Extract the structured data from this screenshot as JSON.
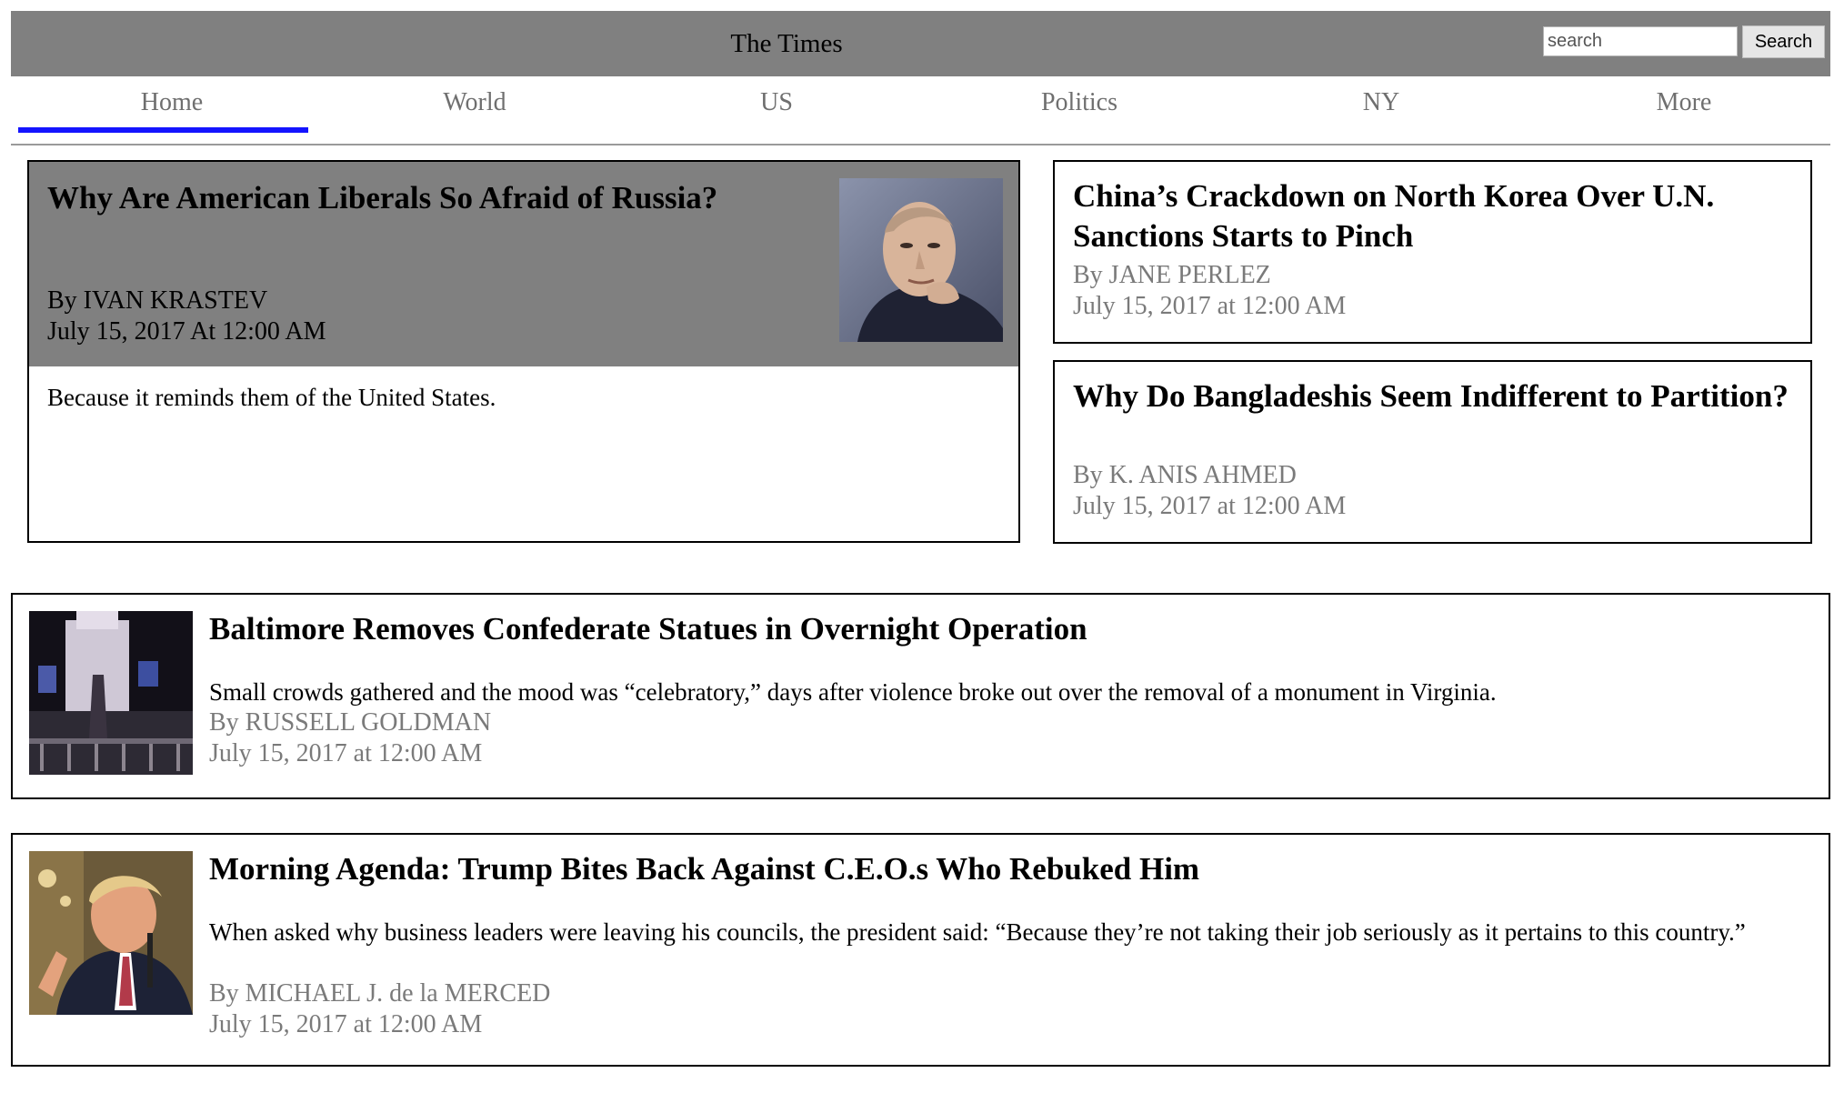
{
  "header": {
    "site_title": "The Times",
    "search_placeholder": "search",
    "search_button_label": "Search",
    "background_color": "#808080"
  },
  "nav": {
    "active_index": 0,
    "underline_color": "#1414ff",
    "tabs": [
      {
        "label": "Home"
      },
      {
        "label": "World"
      },
      {
        "label": "US"
      },
      {
        "label": "Politics"
      },
      {
        "label": "NY"
      },
      {
        "label": "More"
      }
    ]
  },
  "featured": {
    "title": "Why Are American Liberals So Afraid of Russia?",
    "byline": "By IVAN KRASTEV",
    "date": "July 15, 2017 At 12:00 AM",
    "summary": "Because it reminds them of the United States.",
    "photo_icon": "portrait-photo"
  },
  "side_articles": [
    {
      "title": "China’s Crackdown on North Korea Over U.N. Sanctions Starts to Pinch",
      "byline": "By JANE PERLEZ",
      "date": "July 15, 2017 at 12:00 AM"
    },
    {
      "title": "Why Do Bangladeshis Seem Indifferent to Partition?",
      "byline": "By K. ANIS AHMED",
      "date": "July 15, 2017 at 12:00 AM"
    }
  ],
  "list_articles": [
    {
      "title": "Baltimore Removes Confederate Statues in Overnight Operation",
      "summary": "Small crowds gathered and the mood was “celebratory,” days after violence broke out over the removal of a monument in Virginia.",
      "byline": "By RUSSELL GOLDMAN",
      "date": "July 15, 2017 at 12:00 AM",
      "thumb_icon": "night-scene-photo"
    },
    {
      "title": "Morning Agenda: Trump Bites Back Against C.E.O.s Who Rebuked Him",
      "summary": "When asked why business leaders were leaving his councils, the president said: “Because they’re not taking their job seriously as it pertains to this country.”",
      "byline": "By MICHAEL J. de la MERCED",
      "date": "July 15, 2017 at 12:00 AM",
      "thumb_icon": "press-conference-photo"
    }
  ]
}
